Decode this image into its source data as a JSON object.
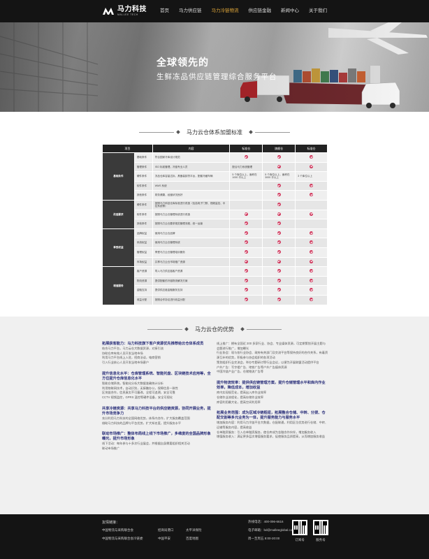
{
  "header": {
    "logo_cn": "马力科技",
    "logo_en": "MALLEE TECH",
    "nav": [
      "首页",
      "马力供应链",
      "马力冷链物流",
      "供应链金融",
      "新闻中心",
      "关于我们"
    ],
    "active_index": 2
  },
  "hero": {
    "title": "全球领先的",
    "subtitle": "生鲜冻品供应链管理综合服务平台"
  },
  "section1": {
    "title": "马力云仓体系加盟标准"
  },
  "table": {
    "headers": [
      "项目",
      "",
      "内容",
      "标准仓",
      "旗舰仓",
      "标准仓"
    ],
    "groups": [
      {
        "name": "基础条件",
        "rows": [
          {
            "item": "基础条件",
            "content": "符合国家冷库设计规范",
            "c1": "tick",
            "c2": "tick",
            "c3": "tick"
          },
          {
            "item": "管理条件",
            "content": "ISO 标准管理，冷链专业人员",
            "c1": "配合马力系统管理",
            "c2": "tick",
            "c3": "tick"
          },
          {
            "item": "硬件条件",
            "content": "冻品仓库容量达标，具备装卸货平台，配套冷藏车辆",
            "c1": "5 个库位以上，面积在 1000 平以上",
            "c2": "5 个库位以上，面积在 3000 平以上",
            "c3": "3 个库位以上"
          },
          {
            "item": "软件条件",
            "content": "WMS 系统",
            "c1": "",
            "c2": "tick",
            "c3": "tick"
          },
          {
            "item": "其他条件",
            "content": "财务健康，经营状况良好",
            "c1": "",
            "c2": "tick",
            "c3": "tick"
          }
        ]
      },
      {
        "name": "改造要求",
        "rows": [
          {
            "item": "硬件条件",
            "content": "按照马力科技仓库标准进行改造（包括电子门禁、视频监控、中控系统等）",
            "c1": "",
            "c2": "tick",
            "c3": ""
          },
          {
            "item": "软件条件",
            "content": "按照马力云仓管理系统进行改造",
            "c1": "tick",
            "c2": "tick",
            "c3": "tick"
          },
          {
            "item": "其他条件",
            "content": "按照马力云仓要求规范管理流程，统一运营",
            "c1": "tick",
            "c2": "tick",
            "c3": ""
          }
        ]
      },
      {
        "name": "享受权益",
        "rows": [
          {
            "item": "品牌权益",
            "content": "使用马力云仓品牌",
            "c1": "tick",
            "c2": "tick",
            "c3": "tick"
          },
          {
            "item": "系统权益",
            "content": "使用马力云仓管理系统",
            "c1": "tick",
            "c2": "tick",
            "c3": "tick"
          },
          {
            "item": "管理权益",
            "content": "享受马力云仓管理培训服务",
            "c1": "tick",
            "c2": "tick",
            "c3": "tick"
          },
          {
            "item": "市场权益",
            "content": "共享马力云仓市场推广资源",
            "c1": "tick",
            "c2": "tick",
            "c3": "tick"
          }
        ]
      },
      {
        "name": "增值服务",
        "rows": [
          {
            "item": "客户资源",
            "content": "导入马力供应链客户资源",
            "c1": "tick",
            "c2": "tick",
            "c3": "tick"
          },
          {
            "item": "物流资源",
            "content": "提供配套的冷链物流解决方案",
            "c1": "tick",
            "c2": "tick",
            "c3": "tick"
          },
          {
            "item": "金融支持",
            "content": "提供供应链金融服务支持",
            "c1": "tick",
            "c2": "tick",
            "c3": "tick"
          },
          {
            "item": "收益分配",
            "content": "按照合作协议进行收益分配",
            "c1": "tick",
            "c2": "tick",
            "c3": "tick"
          }
        ]
      }
    ]
  },
  "section2": {
    "title": "马力云仓的优势"
  },
  "advantages_left": [
    {
      "title": "拓展获客能力：马力科技旗下客户资源优先推荐给云仓体系成员",
      "lines": [
        "结合马力平台，马力云仓大数据资源，对接引流",
        "协助仓库有效人员开发当地市场",
        "利用马力平台线上入驻，招商洽谈，电商营销",
        "引入行业核心人员开发当地市场客户"
      ]
    },
    {
      "title": "提升信息化水平：仓库管理系统、智能托盘、区块链技术应用等，全方位提升仓库信息化水平",
      "lines": [
        "智能仓储系统，智能化分析大数据准确统计分析",
        "利用物联网技术，自动识别，无接触办公，保障信息一致性",
        "区块链合作，信息真实不可篡改，全程可追溯，安全可靠",
        "CCTV 视频监控，GPRS 温控等硬件设备，安全可视化"
      ]
    },
    {
      "title": "共享冷链资源：共享马力科技平台的供应链资源，协同开展业务，提升市场竞争力",
      "lines": [
        "充分利用马力科技的全国网络优势，体系内合作，扩大服务覆盖范围",
        "借助马力科技的品牌与平台优势，扩大知名度，提升服务水平"
      ]
    },
    {
      "title": "联动市场推广：整体布局线上线下市场推广，多维度的全国品牌形象曝光，提升市场形象",
      "lines": [
        "线下活动：每年参与十多次行业展会，并根据自身需要组织相关活动",
        "联动市场推广"
      ]
    }
  ],
  "advantages_right": [
    {
      "title": "",
      "lines": [
        "线上推广：拥有全国近 200 多家行业、协会、专业媒体资源，可定期策划开展主题与会题进行推广，增加曝光",
        "行业协会：现与各行业协会、政府有关部门及交流平台等保持良好的合作关系，有着资源互补的优势，积极参与协会组织的各项活动",
        "策划组织行业交流会，举办专题研讨等行业会议，以便为开展联盟活动提供平台",
        "户外广告：写字楼广告、地铁广告等户外广告媒体资源",
        "中国冷链产业广告，仓储物流广告等"
      ]
    },
    {
      "title": "提升物流效率：提供供应链管理方案，提升仓储管理水平和库内作业效率，降低成本，增加收益",
      "lines": [
        "库内实现规范化，提高出入库作业效率",
        "仓储作业流程化，提高存储作业效率",
        "库容利用最大化，提高空间利用率"
      ]
    },
    {
      "title": "拓展业务范围：成为区域冷链枢纽，拓展整合仓储、中转、分拨、仓配交割等多元业务为一体，提升服务能力与服务水平",
      "lines": [
        "增加服务内容：利用马力冷链平台大数据，仓配联通，利用区位优势进行仓储、中转、运输等服务内容，提高收益",
        "仓单融资服务：引入仓单融资服务，使仓库成为金融合作伙伴，增加服务收入",
        "增值服务收入：满足更多层次增值服务要求，促使服务品质提高，从而增加服务收益"
      ]
    }
  ],
  "footer": {
    "links_label": "友情链接：",
    "links": [
      "中国物流与采购联合会",
      "招商局港口",
      "太平洋保险",
      "中国物流与采购联合会冷链委",
      "中国平安",
      "百度地图"
    ],
    "hotline": "热线电话：400-096-6616",
    "email": "电子邮箱：bd@malleeglobal.com",
    "hours": "周一至周五 8:00-20:00",
    "qr_captions": [
      "订阅号",
      "服务号"
    ]
  }
}
